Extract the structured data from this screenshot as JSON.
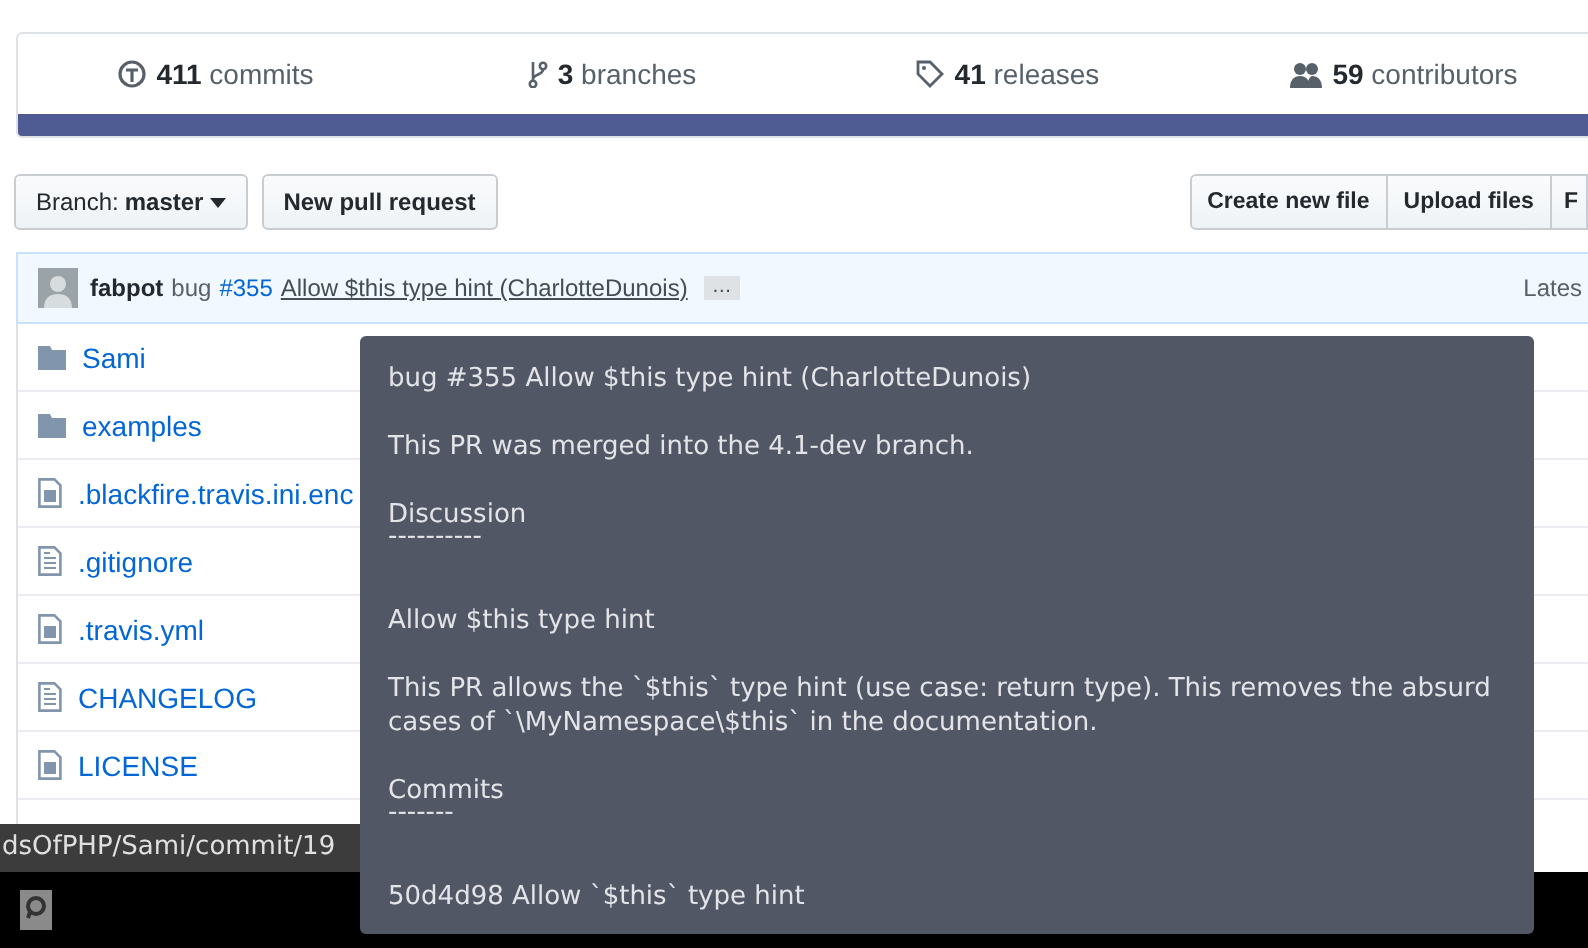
{
  "stats": [
    {
      "kind": "commits",
      "count": "411",
      "label": "commits"
    },
    {
      "kind": "branches",
      "count": "3",
      "label": "branches"
    },
    {
      "kind": "releases",
      "count": "41",
      "label": "releases"
    },
    {
      "kind": "contributors",
      "count": "59",
      "label": "contributors"
    }
  ],
  "branch_button": {
    "label": "Branch:",
    "value": "master"
  },
  "left_buttons": [
    "New pull request"
  ],
  "right_buttons": [
    "Create new file",
    "Upload files",
    "F"
  ],
  "commit": {
    "author": "fabpot",
    "type": "bug",
    "issue": "#355",
    "message": "Allow $this type hint (CharlotteDunois)",
    "more": "…",
    "latest": "Lates"
  },
  "files": [
    {
      "name": "Sami",
      "kind": "folder"
    },
    {
      "name": "examples",
      "kind": "folder"
    },
    {
      "name": ".blackfire.travis.ini.enc",
      "kind": "file"
    },
    {
      "name": ".gitignore",
      "kind": "text-file"
    },
    {
      "name": ".travis.yml",
      "kind": "file"
    },
    {
      "name": "CHANGELOG",
      "kind": "text-file"
    },
    {
      "name": "LICENSE",
      "kind": "file"
    }
  ],
  "tooltip": [
    {
      "kind": "text",
      "text": "bug #355 Allow $this type hint (CharlotteDunois)"
    },
    {
      "kind": "text",
      "text": "This PR was merged into the 4.1-dev branch."
    },
    {
      "kind": "text",
      "text": "Discussion"
    },
    {
      "kind": "rule",
      "text": "----------"
    },
    {
      "kind": "text",
      "text": "Allow $this type hint"
    },
    {
      "kind": "text",
      "text": "This PR allows the `$this` type hint (use case: return type). This removes the absurd cases of `\\MyNamespace\\$this` in the documentation."
    },
    {
      "kind": "text",
      "text": "Commits"
    },
    {
      "kind": "rule",
      "text": "-------"
    },
    {
      "kind": "text",
      "text": "50d4d98 Allow `$this` type hint"
    }
  ],
  "status_url": "dsOfPHP/Sami/commit/19"
}
